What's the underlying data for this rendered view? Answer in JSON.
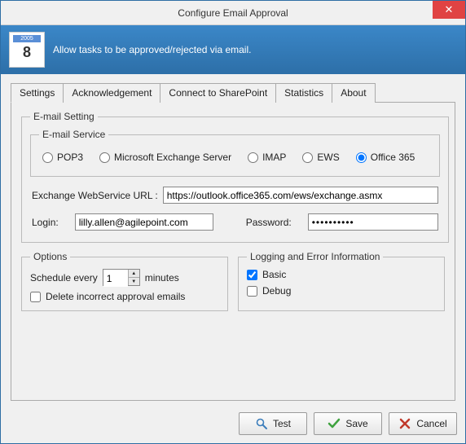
{
  "window": {
    "title": "Configure Email Approval"
  },
  "banner": {
    "description": "Allow tasks to be approved/rejected via email.",
    "icon_day": "8",
    "icon_top": "2005"
  },
  "tabs": {
    "items": [
      {
        "label": "Settings"
      },
      {
        "label": "Acknowledgement"
      },
      {
        "label": "Connect to SharePoint"
      },
      {
        "label": "Statistics"
      },
      {
        "label": "About"
      }
    ],
    "active_index": 0
  },
  "email_setting": {
    "legend": "E-mail Setting",
    "service_legend": "E-mail Service",
    "services": {
      "pop3": "POP3",
      "exchange": "Microsoft Exchange Server",
      "imap": "IMAP",
      "ews": "EWS",
      "office365": "Office 365"
    },
    "selected_service": "office365",
    "url_label": "Exchange WebService URL :",
    "url_value": "https://outlook.office365.com/ews/exchange.asmx",
    "login_label": "Login:",
    "login_value": "lilly.allen@agilepoint.com",
    "password_label": "Password:",
    "password_value": "••••••••••"
  },
  "options": {
    "legend": "Options",
    "schedule_prefix": "Schedule every",
    "schedule_value": "1",
    "schedule_suffix": "minutes",
    "delete_label": "Delete incorrect approval emails",
    "delete_checked": false
  },
  "logging": {
    "legend": "Logging and Error Information",
    "basic_label": "Basic",
    "basic_checked": true,
    "debug_label": "Debug",
    "debug_checked": false
  },
  "buttons": {
    "test": "Test",
    "save": "Save",
    "cancel": "Cancel"
  }
}
